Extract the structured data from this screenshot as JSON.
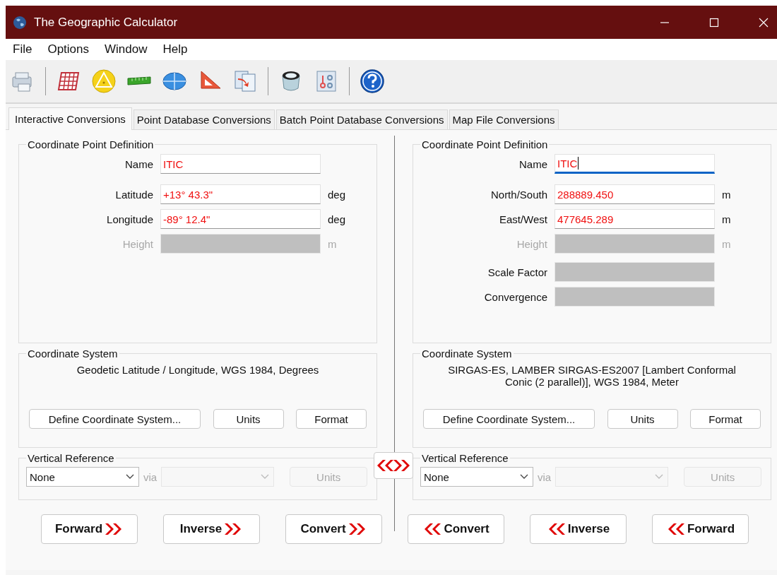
{
  "window": {
    "title": "The Geographic Calculator"
  },
  "menu": [
    "File",
    "Options",
    "Window",
    "Help"
  ],
  "tabs": [
    {
      "label": "Interactive Conversions",
      "selected": true
    },
    {
      "label": "Point Database Conversions",
      "selected": false
    },
    {
      "label": "Batch Point Database Conversions",
      "selected": false
    },
    {
      "label": "Map File Conversions",
      "selected": false
    }
  ],
  "panels": [
    {
      "point_definition": {
        "title": "Coordinate Point Definition",
        "fields": [
          {
            "kind": "input",
            "label": "Name",
            "value": "ITIC",
            "disabled": false,
            "focused": false
          },
          {
            "kind": "input",
            "label": "Latitude",
            "value": "+13° 43.3\"",
            "unit": "deg",
            "disabled": false,
            "focused": false
          },
          {
            "kind": "input",
            "label": "Longitude",
            "value": "-89° 12.4\"",
            "unit": "deg",
            "disabled": false,
            "focused": false
          },
          {
            "kind": "input",
            "label": "Height",
            "unit": "m",
            "disabled": true
          }
        ]
      },
      "coordinate_system": {
        "title": "Coordinate System",
        "description": "Geodetic Latitude / Longitude, WGS 1984, Degrees",
        "buttons": [
          "Define Coordinate System...",
          "Units",
          "Format"
        ]
      },
      "vertical_reference": {
        "title": "Vertical Reference",
        "datum": "None",
        "via": "via",
        "units_button": "Units"
      }
    },
    {
      "point_definition": {
        "title": "Coordinate Point Definition",
        "fields": [
          {
            "kind": "input",
            "label": "Name",
            "value": "ITIC",
            "disabled": false,
            "focused": true
          },
          {
            "kind": "input",
            "label": "North/South",
            "value": "288889.450",
            "unit": "m",
            "disabled": false,
            "focused": false
          },
          {
            "kind": "input",
            "label": "East/West",
            "value": "477645.289",
            "unit": "m",
            "disabled": false,
            "focused": false
          },
          {
            "kind": "input",
            "label": "Height",
            "unit": "m",
            "disabled": true
          },
          {
            "kind": "readout",
            "label": "Scale Factor",
            "disabled": false
          },
          {
            "kind": "readout",
            "label": "Convergence",
            "disabled": false
          }
        ]
      },
      "coordinate_system": {
        "title": "Coordinate System",
        "description": "SIRGAS-ES, LAMBER SIRGAS-ES2007 [Lambert Conformal Conic (2 parallel)], WGS 1984, Meter",
        "buttons": [
          "Define Coordinate System...",
          "Units",
          "Format"
        ]
      },
      "vertical_reference": {
        "title": "Vertical Reference",
        "datum": "None",
        "via": "via",
        "units_button": "Units"
      }
    }
  ],
  "actions": [
    {
      "label": "Forward",
      "kind": "right"
    },
    {
      "label": "Inverse",
      "kind": "right"
    },
    {
      "label": "Convert",
      "kind": "right"
    },
    {
      "label": "Convert",
      "kind": "left"
    },
    {
      "label": "Inverse",
      "kind": "left"
    },
    {
      "label": "Forward",
      "kind": "left"
    }
  ]
}
